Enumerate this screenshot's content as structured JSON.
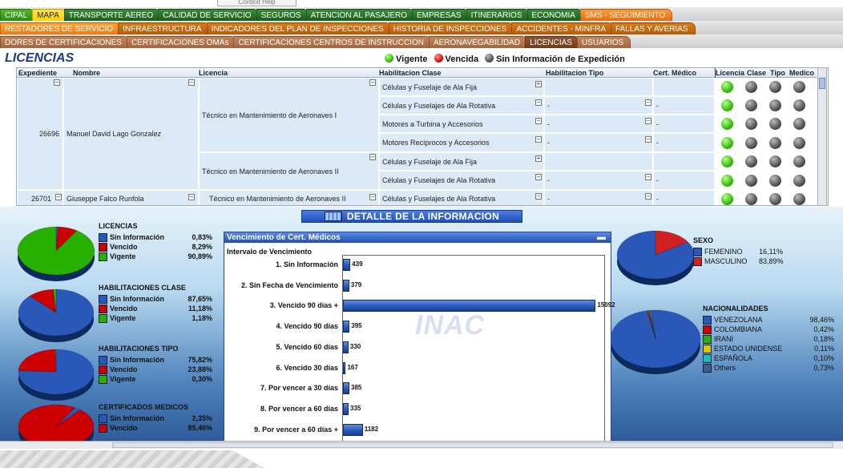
{
  "tooltip": "Context Help",
  "tabs_row1": [
    "CIPAL",
    "MAPA",
    "TRANSPORTE AEREO",
    "CALIDAD DE SERVICIO",
    "SEGUROS",
    "ATENCION AL PASAJERO",
    "EMPRESAS",
    "ITINERARIOS",
    "ECONOMIA",
    "SMS - SEGUIMIENTO"
  ],
  "tabs_row2": [
    "RESTADORES DE SERVICIO",
    "INFRAESTRUCTURA",
    "INDICADORES DEL PLAN DE INSPECCIONES",
    "HISTORIA DE INSPECCIONES",
    "ACCIDENTES - MINFRA",
    "FALLAS Y AVERIAS"
  ],
  "tabs_row3": [
    "DORES DE CERTIFICACIONES",
    "CERTIFICACIONES OMAs",
    "CERTIFICACIONES CENTROS DE INSTRUCCION",
    "AERONAVEGABILIDAD",
    "LICENCIAS",
    "USUARIOS"
  ],
  "colors": {
    "green": "#27b000",
    "red": "#cc0000",
    "gray": "#555555",
    "blue": "#2a58b8"
  },
  "title": "LICENCIAS",
  "legend": {
    "vigente": "Vigente",
    "vencida": "Vencida",
    "sin_info": "Sin Información de Expedición"
  },
  "table": {
    "headers": {
      "expediente": "Expediente",
      "nombre": "Nombre",
      "licencia": "Licencia",
      "hab_clase": "Habilitacion Clase",
      "hab_tipo": "Habilitacion Tipo",
      "cert_medico": "Cert. Médico",
      "ind_licencia": "Licencia",
      "ind_clase": "Clase",
      "ind_tipo": "Tipo",
      "ind_medico": "Medico"
    },
    "person1": {
      "expediente": "26696",
      "nombre": "Manuel David Lago Gonzalez",
      "lic1": "Técnico en Mantenimiento de Aeronaves I",
      "lic2": "Técnico en Mantenimiento de Aeronaves II"
    },
    "person2": {
      "expediente": "26701",
      "nombre": "Giuseppe Falco Runfola",
      "lic": "Técnico en Mantenimiento de Aeronaves II"
    },
    "rows": [
      {
        "clase": "Células y Fuselaje de Ala Fija",
        "tipo": "",
        "cert": ""
      },
      {
        "clase": "Células y Fuselajes de Ala Rotativa",
        "tipo": "-",
        "cert": "-"
      },
      {
        "clase": "Motores a Turbina y Accesorios",
        "tipo": "-",
        "cert": "-"
      },
      {
        "clase": "Motores Recíprocos y Accesorios",
        "tipo": "-",
        "cert": "-"
      },
      {
        "clase": "Células y Fuselaje de Ala Fija",
        "tipo": "",
        "cert": ""
      },
      {
        "clase": "Células y Fuselajes de Ala Rotativa",
        "tipo": "-",
        "cert": "-"
      },
      {
        "clase": "Células y Fuselajes de Ala Rotativa",
        "tipo": "-",
        "cert": "-"
      }
    ]
  },
  "detalle": "DETALLE DE LA INFORMACION",
  "licencias_pie": {
    "title": "LICENCIAS",
    "items": [
      {
        "label": "Sin Información",
        "value": "0,83%",
        "pct": 0.83
      },
      {
        "label": "Vencido",
        "value": "8,29%",
        "pct": 8.29
      },
      {
        "label": "Vigente",
        "value": "90,89%",
        "pct": 90.89
      }
    ]
  },
  "hab_clase_pie": {
    "title": "HABILITACIONES CLASE",
    "items": [
      {
        "label": "Sin Información",
        "value": "87,65%",
        "pct": 87.65
      },
      {
        "label": "Vencido",
        "value": "11,18%",
        "pct": 11.18
      },
      {
        "label": "Vigente",
        "value": "1,18%",
        "pct": 1.18
      }
    ]
  },
  "hab_tipo_pie": {
    "title": "HABILITACIONES TIPO",
    "items": [
      {
        "label": "Sin Información",
        "value": "75,82%",
        "pct": 75.82
      },
      {
        "label": "Vencido",
        "value": "23,88%",
        "pct": 23.88
      },
      {
        "label": "Vigente",
        "value": "0,30%",
        "pct": 0.3
      }
    ]
  },
  "cert_med_pie": {
    "title": "CERTIFICADOS MEDICOS",
    "items": [
      {
        "label": "Sin Información",
        "value": "2,35%",
        "pct": 2.35
      },
      {
        "label": "Vencido",
        "value": "85,46%",
        "pct": 85.46
      }
    ]
  },
  "sexo_pie": {
    "title": "SEXO",
    "items": [
      {
        "label": "FEMENINO",
        "value": "16,11%",
        "pct": 16.11
      },
      {
        "label": "MASCULINO",
        "value": "83,89%",
        "pct": 83.89
      }
    ]
  },
  "nac_pie": {
    "title": "NACIONALIDADES",
    "items": [
      {
        "label": "VENEZOLANA",
        "value": "98,46%",
        "pct": 98.46,
        "color": "#2a58b8"
      },
      {
        "label": "COLOMBIANA",
        "value": "0,42%",
        "pct": 0.42,
        "color": "#cc0000"
      },
      {
        "label": "IRANI",
        "value": "0,18%",
        "pct": 0.18,
        "color": "#27b000"
      },
      {
        "label": "ESTADO UNIDENSE",
        "value": "0,11%",
        "pct": 0.11,
        "color": "#e0c400"
      },
      {
        "label": "ESPAÑOLA",
        "value": "0,10%",
        "pct": 0.1,
        "color": "#1bb9b9"
      },
      {
        "label": "Others",
        "value": "0,73%",
        "pct": 0.73,
        "color": "#3e5f8e"
      }
    ]
  },
  "chart_data": {
    "type": "bar",
    "title": "Vencimiento de Cert. Médicos",
    "subtitle": "Intervalo de Vencimiento",
    "categories": [
      "1. Sin Información",
      "2. Sin Fecha de Vencimiento",
      "3. Vencido 90 días +",
      "4. Vencido 90 días",
      "5. Vencido 60 días",
      "6. Vencido 30 días",
      "7. Por vencer a 30 días",
      "8. Por vencer a 60 días",
      "9. Por vencer a 60 días +"
    ],
    "values": [
      439,
      379,
      15092,
      395,
      330,
      167,
      385,
      335,
      1182
    ],
    "labels": [
      "439",
      "379",
      "15092",
      "395",
      "330",
      "167",
      "385",
      "335",
      "1182"
    ],
    "xlim": [
      0,
      15600
    ],
    "orientation": "horizontal"
  },
  "watermark": "INAC"
}
